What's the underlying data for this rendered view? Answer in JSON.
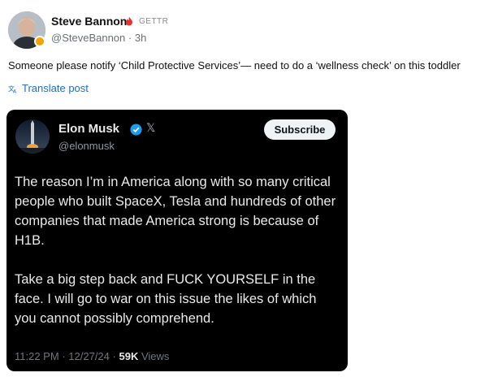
{
  "post": {
    "author": "Steve Bannon",
    "platform": "GETTR",
    "handle": "@SteveBannon",
    "separator": "·",
    "time": "3h",
    "text": "Someone please notify ‘Child Protective Services’— need to do a ‘wellness check’ on this toddler",
    "translate_label": "Translate post",
    "icons": {
      "avatar": "profile-photo",
      "badge": "verified-badge-icon",
      "platform": "fire-icon",
      "translate": "translate-icon"
    }
  },
  "embed": {
    "author": "Elon Musk",
    "handle": "@elonmusk",
    "subscribe_label": "Subscribe",
    "x_logo": "𝕏",
    "paragraphs": [
      "The reason I’m in America along with so many critical people who built SpaceX, Tesla and hundreds of other companies that made America strong is because of H1B.",
      "Take a big step back and FUCK YOURSELF in the face. I will go to war on this issue the likes of which you cannot possibly comprehend."
    ],
    "time": "11:22 PM",
    "date": "12/27/24",
    "sep": "·",
    "views_count": "59K",
    "views_label": "Views"
  },
  "colors": {
    "link": "#1d6fc6",
    "embed_bg": "#000000",
    "embed_text": "#e7e9ea",
    "muted": "#71767b",
    "verified_blue": "#1d9bf0",
    "gettr_red": "#e8312f",
    "badge_gold": "#f6a300"
  }
}
